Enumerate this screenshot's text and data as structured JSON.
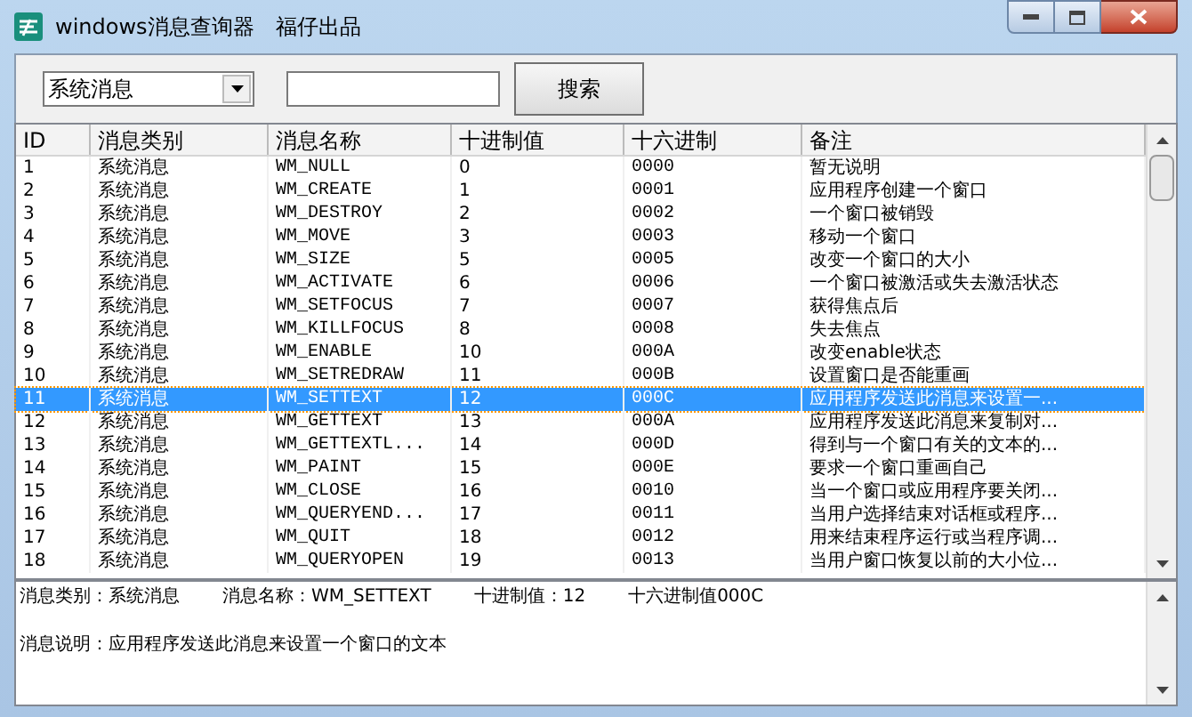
{
  "window": {
    "title": "windows消息查询器",
    "subtitle": "福仔出品"
  },
  "toolbar": {
    "category": "系统消息",
    "search_button": "搜索"
  },
  "table": {
    "columns": [
      "ID",
      "消息类别",
      "消息名称",
      "十进制值",
      "十六进制",
      "备注"
    ],
    "rows": [
      {
        "cells": [
          "1",
          "系统消息",
          "WM_NULL",
          "0",
          "0000",
          "暂无说明"
        ],
        "selected": false
      },
      {
        "cells": [
          "2",
          "系统消息",
          "WM_CREATE",
          "1",
          "0001",
          "应用程序创建一个窗口"
        ],
        "selected": false
      },
      {
        "cells": [
          "3",
          "系统消息",
          "WM_DESTROY",
          "2",
          "0002",
          "一个窗口被销毁"
        ],
        "selected": false
      },
      {
        "cells": [
          "4",
          "系统消息",
          "WM_MOVE",
          "3",
          "0003",
          "移动一个窗口"
        ],
        "selected": false
      },
      {
        "cells": [
          "5",
          "系统消息",
          "WM_SIZE",
          "5",
          "0005",
          "改变一个窗口的大小"
        ],
        "selected": false
      },
      {
        "cells": [
          "6",
          "系统消息",
          "WM_ACTIVATE",
          "6",
          "0006",
          "一个窗口被激活或失去激活状态"
        ],
        "selected": false
      },
      {
        "cells": [
          "7",
          "系统消息",
          "WM_SETFOCUS",
          "7",
          "0007",
          "获得焦点后"
        ],
        "selected": false
      },
      {
        "cells": [
          "8",
          "系统消息",
          "WM_KILLFOCUS",
          "8",
          "0008",
          "失去焦点"
        ],
        "selected": false
      },
      {
        "cells": [
          "9",
          "系统消息",
          "WM_ENABLE",
          "10",
          "000A",
          "改变enable状态"
        ],
        "selected": false
      },
      {
        "cells": [
          "10",
          "系统消息",
          "WM_SETREDRAW",
          "11",
          "000B",
          "设置窗口是否能重画"
        ],
        "selected": false
      },
      {
        "cells": [
          "11",
          "系统消息",
          "WM_SETTEXT",
          "12",
          "000C",
          "应用程序发送此消息来设置一..."
        ],
        "selected": true
      },
      {
        "cells": [
          "12",
          "系统消息",
          "WM_GETTEXT",
          "13",
          "000A",
          "应用程序发送此消息来复制对..."
        ],
        "selected": false
      },
      {
        "cells": [
          "13",
          "系统消息",
          "WM_GETTEXTL...",
          "14",
          "000D",
          "得到与一个窗口有关的文本的..."
        ],
        "selected": false
      },
      {
        "cells": [
          "14",
          "系统消息",
          "WM_PAINT",
          "15",
          "000E",
          "要求一个窗口重画自己"
        ],
        "selected": false
      },
      {
        "cells": [
          "15",
          "系统消息",
          "WM_CLOSE",
          "16",
          "0010",
          "当一个窗口或应用程序要关闭..."
        ],
        "selected": false
      },
      {
        "cells": [
          "16",
          "系统消息",
          "WM_QUERYEND...",
          "17",
          "0011",
          "当用户选择结束对话框或程序..."
        ],
        "selected": false
      },
      {
        "cells": [
          "17",
          "系统消息",
          "WM_QUIT",
          "18",
          "0012",
          "用来结束程序运行或当程序调..."
        ],
        "selected": false
      },
      {
        "cells": [
          "18",
          "系统消息",
          "WM_QUERYOPEN",
          "19",
          "0013",
          "当用户窗口恢复以前的大小位..."
        ],
        "selected": false
      }
    ]
  },
  "details": {
    "fields": [
      "消息类别：系统消息",
      "消息名称：WM_SETTEXT",
      "十进制值：12",
      "十六进制值000C"
    ],
    "description": "消息说明：应用程序发送此消息来设置一个窗口的文本"
  }
}
